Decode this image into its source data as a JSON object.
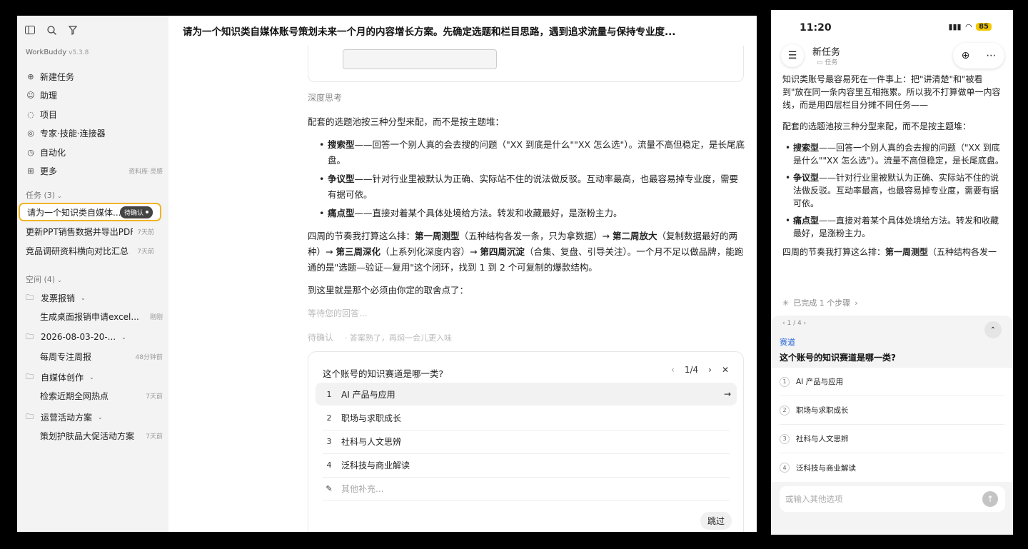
{
  "desktop": {
    "sidebar": {
      "app_name": "WorkBuddy",
      "version": "v5.3.8",
      "icons": [
        "sidebar-toggle-icon",
        "search-icon",
        "filter-icon"
      ],
      "nav": [
        {
          "label": "新建任务",
          "icon": "plus-circle-icon",
          "hint": ""
        },
        {
          "label": "助理",
          "icon": "assistant-icon",
          "hint": ""
        },
        {
          "label": "项目",
          "icon": "project-icon",
          "hint": ""
        },
        {
          "label": "专家·技能·连接器",
          "icon": "expert-icon",
          "hint": ""
        },
        {
          "label": "自动化",
          "icon": "clock-icon",
          "hint": ""
        },
        {
          "label": "更多",
          "icon": "grid-icon",
          "hint": "资料库·灵感"
        }
      ],
      "tasks_header": "任务 (3)",
      "tasks": [
        {
          "title": "请为一个知识类自媒体...",
          "badge": "待确认",
          "age": ""
        },
        {
          "title": "更新PPT销售数据并导出PDF",
          "badge": "",
          "age": "7天前"
        },
        {
          "title": "竞品调研资料横向对比汇总",
          "badge": "",
          "age": "7天前"
        }
      ],
      "spaces_header": "空间 (4)",
      "spaces": [
        {
          "name": "发票报销",
          "items": [
            {
              "title": "生成桌面报销申请excel...",
              "age": "刚刚"
            }
          ]
        },
        {
          "name": "2026-08-03-20-...",
          "items": [
            {
              "title": "每周专注周报",
              "age": "48分钟前"
            }
          ]
        },
        {
          "name": "自媒体创作",
          "items": [
            {
              "title": "检索近期全网热点",
              "age": "7天前"
            }
          ]
        },
        {
          "name": "运营活动方案",
          "items": [
            {
              "title": "策划护肤品大促活动方案",
              "age": "7天前"
            }
          ]
        }
      ]
    },
    "header_title": "请为一个知识类自媒体账号策划未来一个月的内容增长方案。先确定选题和栏目思路，遇到追求流量与保持专业度...",
    "deep_thinking": "深度思考",
    "body": {
      "p1": "配套的选题池按三种分型来配，而不是按主题堆：",
      "bullets": [
        {
          "bold": "搜索型",
          "text": "——回答一个别人真的会去搜的问题（\"XX 到底是什么\"\"XX 怎么选\"）。流量不高但稳定，是长尾底盘。"
        },
        {
          "bold": "争议型",
          "text": "——针对行业里被默认为正确、实际站不住的说法做反驳。互动率最高，也最容易掉专业度，需要有据可依。"
        },
        {
          "bold": "痛点型",
          "text": "——直接对着某个具体处境给方法。转发和收藏最好，是涨粉主力。"
        }
      ],
      "p2_a": "四周的节奏我打算这么排：",
      "w1": "第一周测型",
      "p2_b": "（五种结构各发一条，只为拿数据）→ ",
      "w2": "第二周放大",
      "p2_c": "（复制数据最好的两种）→ ",
      "w3": "第三周深化",
      "p2_d": "（上系列化深度内容）→ ",
      "w4": "第四周沉淀",
      "p2_e": "（合集、复盘、引导关注）。一个月不足以做品牌，能跑通的是\"选题—验证—复用\"这个闭环，找到 1 到 2 个可复制的爆款结构。",
      "p3": "到这里就是那个必须由你定的取舍点了："
    },
    "waiting": "等待您的回答...",
    "status": "待确认",
    "status_note": "· 答案熟了，再焖一会儿更入味",
    "question": {
      "title": "这个账号的知识赛道是哪一类?",
      "page": "1/4",
      "options": [
        {
          "num": "1",
          "label": "AI 产品与应用"
        },
        {
          "num": "2",
          "label": "职场与求职成长"
        },
        {
          "num": "3",
          "label": "社科与人文思辨"
        },
        {
          "num": "4",
          "label": "泛科技与商业解读"
        }
      ],
      "other": "其他补充...",
      "skip": "跳过"
    }
  },
  "phone": {
    "time": "11:20",
    "battery": "85",
    "title": "新任务",
    "subtitle": "任务",
    "body": {
      "p0": "知识类账号最容易死在一件事上：把\"讲清楚\"和\"被看到\"放在同一条内容里互相拖累。所以我不打算做单一内容线，而是用四层栏目分摊不同任务——",
      "p1": "配套的选题池按三种分型来配，而不是按主题堆：",
      "bullets": [
        {
          "bold": "搜索型",
          "text": "——回答一个别人真的会去搜的问题（\"XX 到底是什么\"\"XX 怎么选\"）。流量不高但稳定，是长尾底盘。"
        },
        {
          "bold": "争议型",
          "text": "——针对行业里被默认为正确、实际站不住的说法做反驳。互动率最高，也最容易掉专业度，需要有据可依。"
        },
        {
          "bold": "痛点型",
          "text": "——直接对着某个具体处境给方法。转发和收藏最好，是涨粉主力。"
        }
      ],
      "p2a": "四周的节奏我打算这么排：",
      "p2b": "第一周测型",
      "p2c": "（五种结构各发一"
    },
    "steps": "已完成 1 个步骤",
    "panel": {
      "page": "1 / 4",
      "category": "赛道",
      "question": "这个账号的知识赛道是哪一类?",
      "options": [
        {
          "num": "1",
          "label": "AI 产品与应用"
        },
        {
          "num": "2",
          "label": "职场与求职成长"
        },
        {
          "num": "3",
          "label": "社科与人文思辨"
        },
        {
          "num": "4",
          "label": "泛科技与商业解读"
        }
      ],
      "input_placeholder": "或输入其他选项"
    }
  }
}
